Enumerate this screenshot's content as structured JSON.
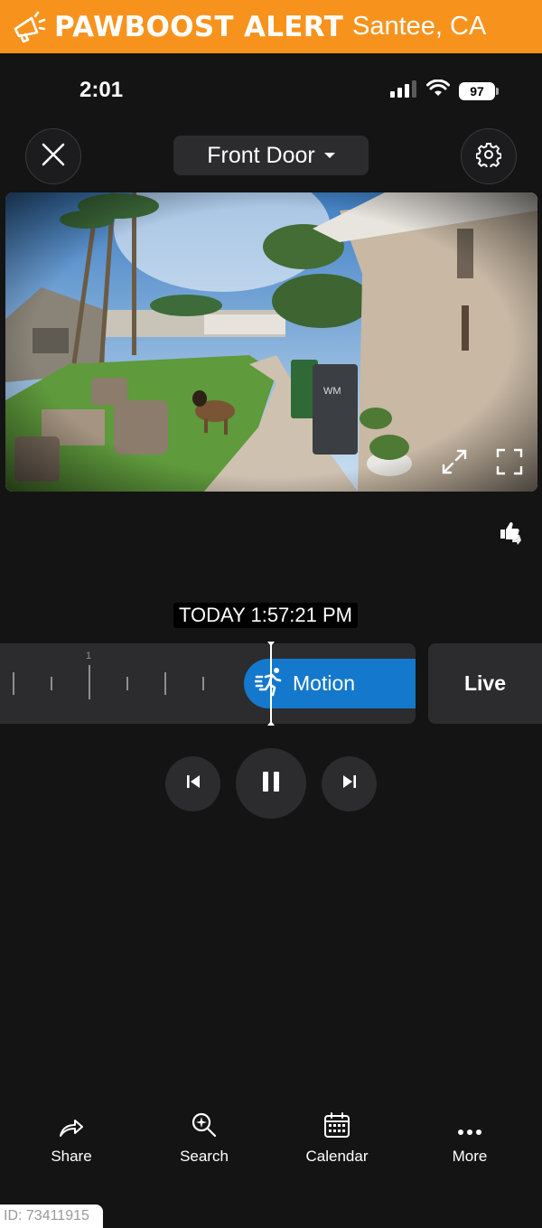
{
  "alert": {
    "title": "PAWBOOST ALERT",
    "city": "Santee, CA"
  },
  "status": {
    "time": "2:01",
    "battery": "97"
  },
  "header": {
    "device_name": "Front Door"
  },
  "timeline": {
    "timestamp": "TODAY 1:57:21 PM",
    "tick_label": "1",
    "motion_label": "Motion",
    "live_label": "Live"
  },
  "nav": {
    "share": "Share",
    "search": "Search",
    "calendar": "Calendar",
    "more": "More"
  },
  "footer": {
    "id_label": "ID: 73411915"
  },
  "colors": {
    "alert_orange": "#f7931d",
    "motion_blue": "#1479cc",
    "background": "#141414"
  }
}
